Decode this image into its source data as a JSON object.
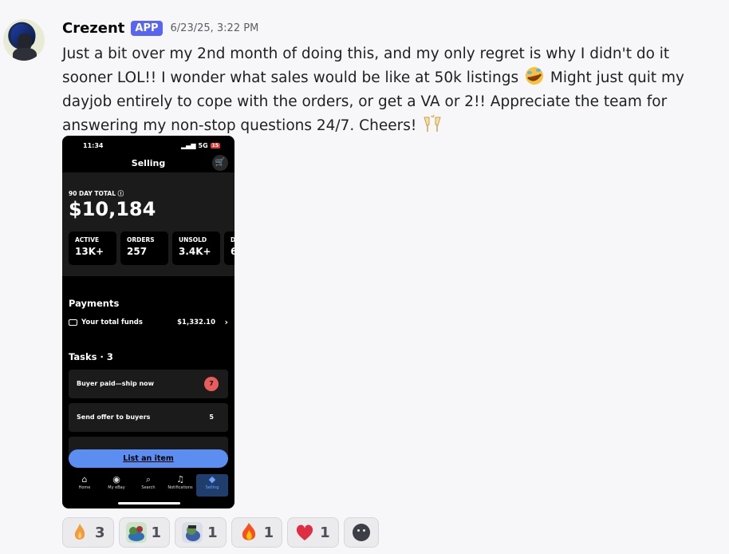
{
  "author": {
    "name": "Crezent",
    "badge": "APP",
    "timestamp": "6/23/25, 3:22 PM"
  },
  "message": {
    "part1": "Just a bit over my 2nd month of doing this, and my only regret is why I didn't do it sooner LOL!! I wonder what sales would be like at 50k listings ",
    "emoji1": "rolling-on-floor-laughing",
    "part2": " Might just quit my dayjob entirely to cope with the orders, or get a VA or 2!! Appreciate the team for answering my non-stop questions 24/7. Cheers! ",
    "emoji2": "clinking-glasses"
  },
  "phone": {
    "time": "11:34",
    "network": "5G",
    "battery": "15",
    "title": "Selling",
    "ninety_day_label": "90 DAY TOTAL",
    "ninety_day_total": "$10,184",
    "stats": [
      {
        "label": "ACTIVE",
        "value": "13K+"
      },
      {
        "label": "ORDERS",
        "value": "257"
      },
      {
        "label": "UNSOLD",
        "value": "3.4K+"
      },
      {
        "label": "D",
        "value": "6"
      }
    ],
    "payments_title": "Payments",
    "funds_label": "Your total funds",
    "funds_value": "$1,332.10",
    "tasks_title": "Tasks · 3",
    "tasks": [
      {
        "label": "Buyer paid—ship now",
        "count": "7"
      },
      {
        "label": "Send offer to buyers",
        "count": "5"
      }
    ],
    "cta": "List an item",
    "nav": [
      "Home",
      "My eBay",
      "Search",
      "Notifications",
      "Selling"
    ]
  },
  "reactions": [
    {
      "emoji": "custom-flame-icon",
      "count": "3"
    },
    {
      "emoji": "custom-frog-icon",
      "count": "1"
    },
    {
      "emoji": "custom-pepe-icon",
      "count": "1"
    },
    {
      "emoji": "fire",
      "count": "1"
    },
    {
      "emoji": "red-heart",
      "count": "1"
    }
  ],
  "colors": {
    "badge": "#5865f2",
    "cta": "#5b8ef0",
    "task_pill": "#e85c5c"
  }
}
